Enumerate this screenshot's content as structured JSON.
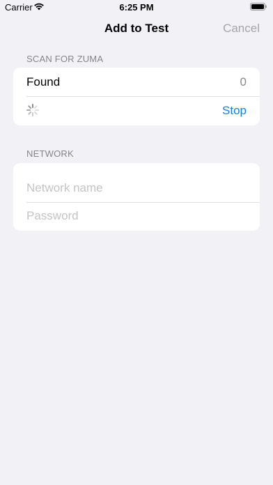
{
  "status_bar": {
    "carrier": "Carrier",
    "time": "6:25 PM",
    "icons": [
      "wifi-icon",
      "battery-icon"
    ]
  },
  "nav": {
    "title": "Add to Test",
    "cancel_label": "Cancel"
  },
  "scan_section": {
    "header": "SCAN FOR ZUMA",
    "found_label": "Found",
    "found_count": "0",
    "spinner_icon": "activity-spinner-icon",
    "stop_label": "Stop"
  },
  "network_section": {
    "header": "NETWORK",
    "name_placeholder": "Network name",
    "name_value": "",
    "password_placeholder": "Password",
    "password_value": ""
  },
  "colors": {
    "background": "#f2f1f6",
    "accent": "#1a7bf2",
    "disabled": "#a5a5aa",
    "secondary_text": "#858589"
  }
}
